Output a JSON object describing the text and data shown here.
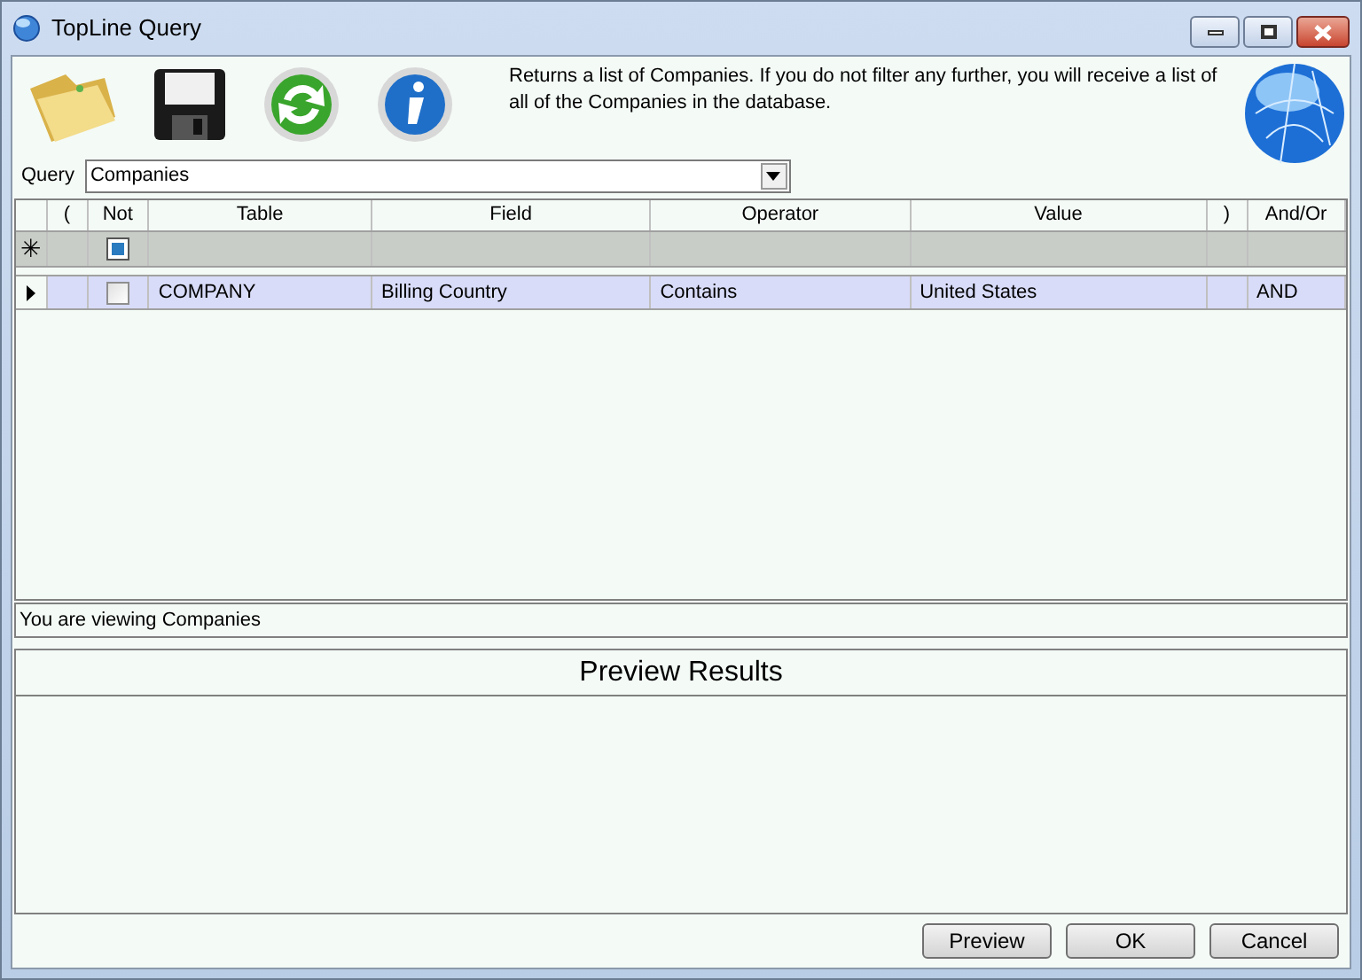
{
  "window": {
    "title": "TopLine Query"
  },
  "description": "Returns a list of Companies.  If you do not filter any further, you will receive a list of all of the Companies in the database.",
  "query": {
    "label": "Query",
    "value": "Companies"
  },
  "grid": {
    "columns": [
      "(",
      "Not",
      "Table",
      "Field",
      "Operator",
      "Value",
      ")",
      "And/Or"
    ],
    "new_row": {
      "marker": "✳",
      "not_default": true
    },
    "rows": [
      {
        "current": true,
        "not": false,
        "cells": [
          "",
          "",
          "COMPANY",
          "Billing Country",
          "Contains",
          "United States",
          "",
          "AND"
        ]
      }
    ]
  },
  "status": "You are viewing Companies",
  "preview": {
    "title": "Preview Results"
  },
  "buttons": [
    "Preview",
    "OK",
    "Cancel"
  ]
}
